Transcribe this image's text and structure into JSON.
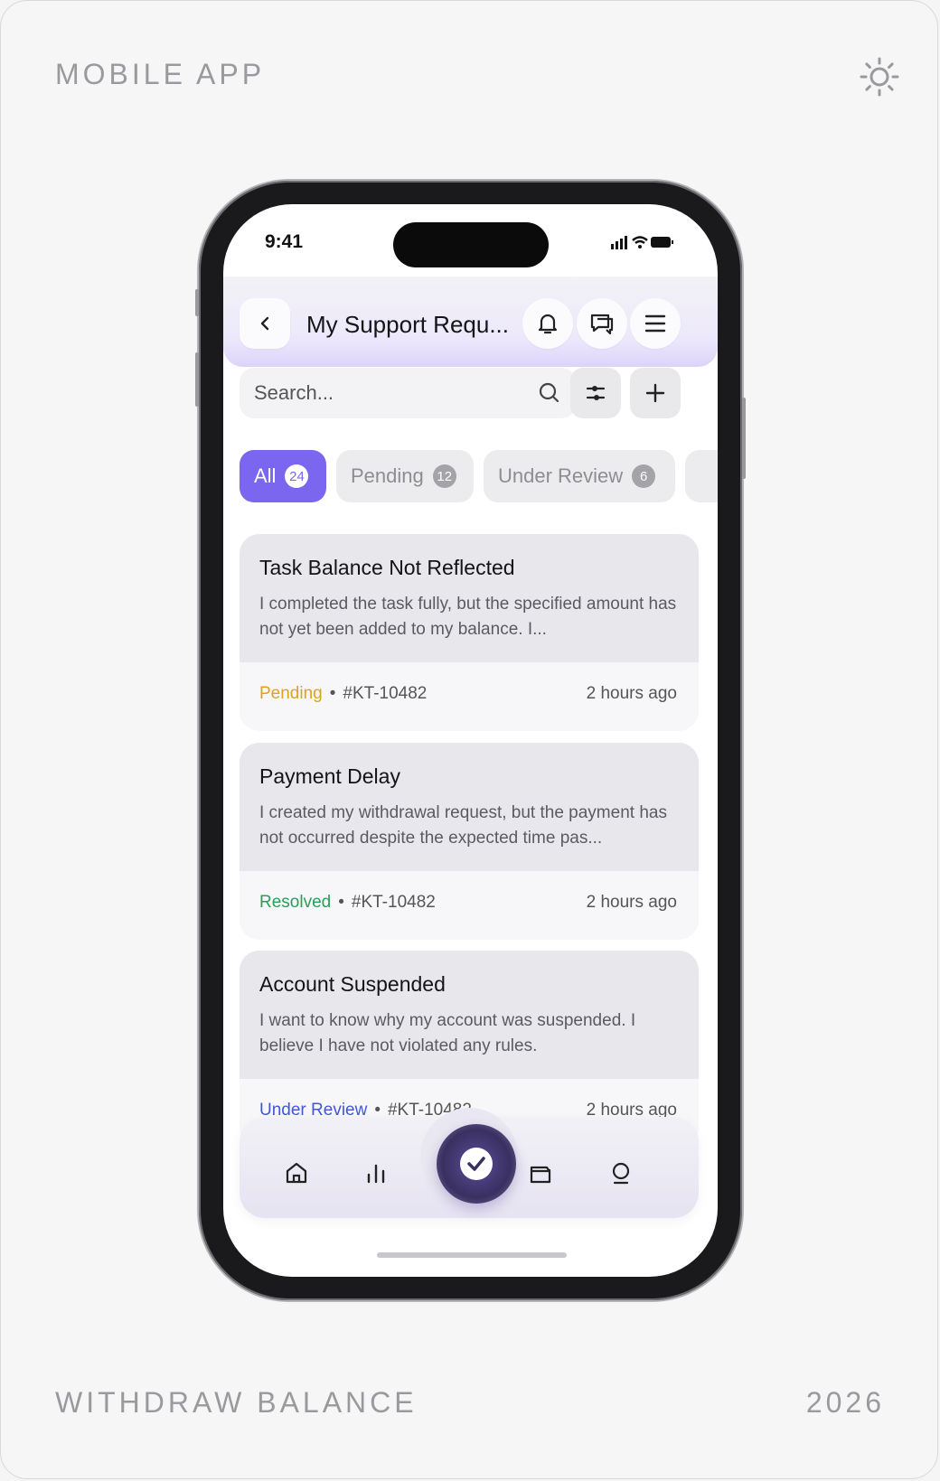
{
  "frame": {
    "top_left_label": "MOBILE APP",
    "bottom_left_label": "WITHDRAW BALANCE",
    "bottom_right_label": "2026",
    "theme_icon": "sun-icon"
  },
  "status_bar": {
    "time": "9:41"
  },
  "header": {
    "title": "My Support Requ...",
    "back_icon": "chevron-left-icon",
    "bell_icon": "bell-icon",
    "chat_icon": "chat-icon",
    "menu_icon": "menu-icon"
  },
  "search": {
    "placeholder": "Search..."
  },
  "tabs": [
    {
      "label": "All",
      "count": "24",
      "active": true
    },
    {
      "label": "Pending",
      "count": "12",
      "active": false
    },
    {
      "label": "Under Review",
      "count": "6",
      "active": false
    }
  ],
  "requests": [
    {
      "title": "Task Balance Not Reflected",
      "description": "I completed the task fully, but the specified amount has not yet been added to my balance. I...",
      "status": "Pending",
      "id": "#KT-10482",
      "time": "2 hours ago"
    },
    {
      "title": "Payment Delay",
      "description": "I created my withdrawal request, but the payment has not occurred despite the expected time pas...",
      "status": "Resolved",
      "id": "#KT-10482",
      "time": "2 hours ago"
    },
    {
      "title": "Account Suspended",
      "description": "I want to know why my account was suspended. I believe I have not violated any rules.",
      "status": "Under Review",
      "id": "#KT-10482",
      "time": "2 hours ago"
    }
  ],
  "status_colors": {
    "Pending": "#e0a21c",
    "Resolved": "#27a058",
    "Under Review": "#4257d6"
  },
  "accent_color": "#7b66f0",
  "bottom_nav": [
    "home-icon",
    "stats-icon",
    "requests-check-icon",
    "wallet-icon",
    "profile-icon"
  ]
}
